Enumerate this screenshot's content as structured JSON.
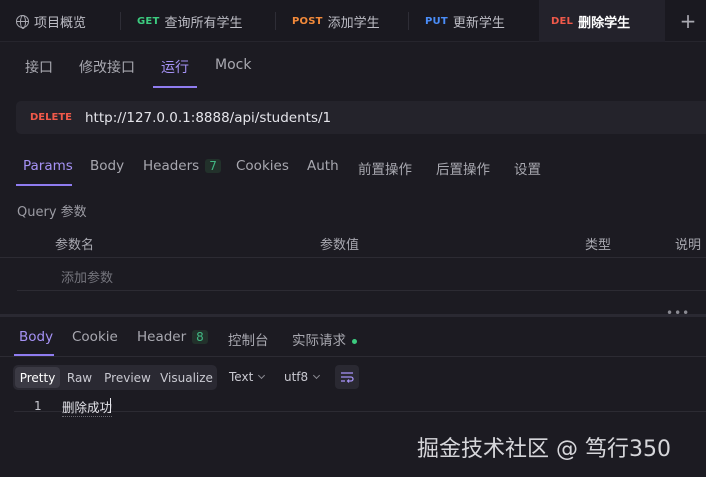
{
  "tabs": [
    {
      "method": "",
      "label": "项目概览",
      "icon": "globe-icon"
    },
    {
      "method": "GET",
      "label": "查询所有学生",
      "color": "#3ccb7f"
    },
    {
      "method": "POST",
      "label": "添加学生",
      "color": "#f38a3a"
    },
    {
      "method": "PUT",
      "label": "更新学生",
      "color": "#4a8df8"
    },
    {
      "method": "DEL",
      "label": "删除学生",
      "color": "#f0594a"
    }
  ],
  "add_tab": "+",
  "subtabs": [
    "接口",
    "修改接口",
    "运行",
    "Mock"
  ],
  "request": {
    "method": "DELETE",
    "url": "http://127.0.0.1:8888/api/students/1"
  },
  "request_tabs": [
    {
      "label": "Params"
    },
    {
      "label": "Body"
    },
    {
      "label": "Headers",
      "badge": "7"
    },
    {
      "label": "Cookies"
    },
    {
      "label": "Auth"
    },
    {
      "label": "前置操作"
    },
    {
      "label": "后置操作"
    },
    {
      "label": "设置"
    }
  ],
  "query": {
    "title": "Query 参数",
    "columns": [
      "参数名",
      "参数值",
      "类型",
      "说明"
    ],
    "add_placeholder": "添加参数"
  },
  "resize_handle": "•••",
  "response_tabs": [
    {
      "label": "Body"
    },
    {
      "label": "Cookie"
    },
    {
      "label": "Header",
      "badge": "8"
    },
    {
      "label": "控制台"
    },
    {
      "label": "实际请求"
    }
  ],
  "format_modes": [
    "Pretty",
    "Raw",
    "Preview",
    "Visualize"
  ],
  "format_type": "Text",
  "encoding": "utf8",
  "body": {
    "line": "1",
    "content": "删除成功"
  },
  "watermark": "掘金技术社区 @ 笃行350"
}
